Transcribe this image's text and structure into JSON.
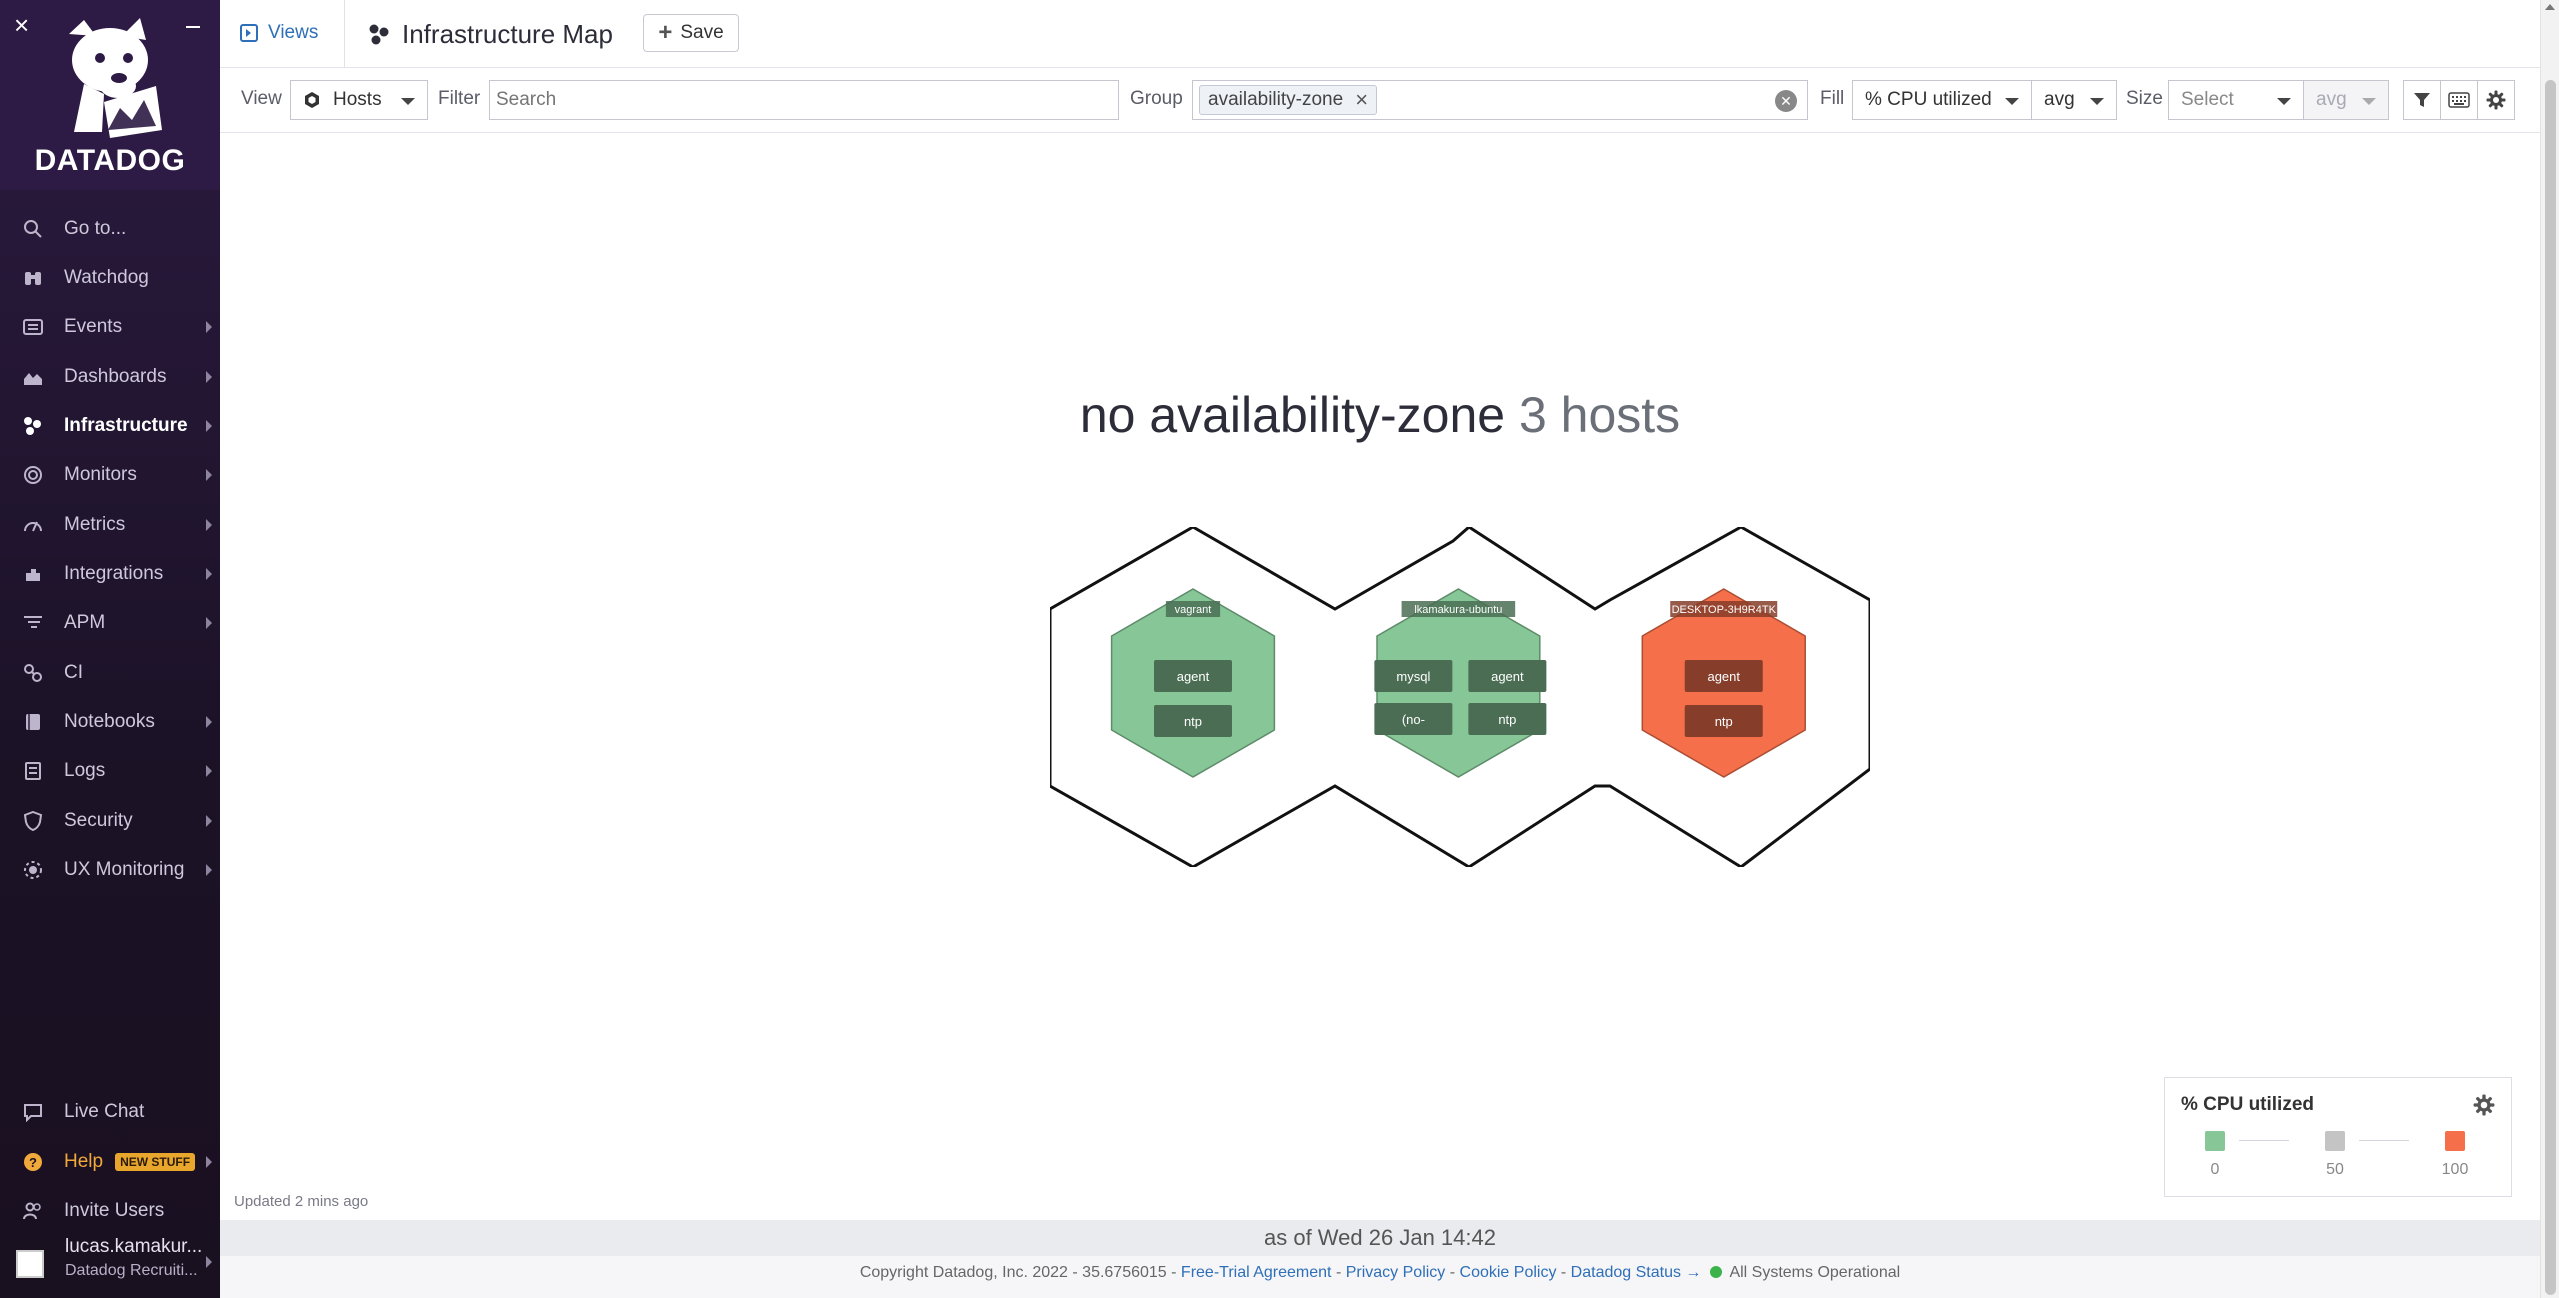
{
  "sidebar": {
    "logo_text": "DATADOG",
    "items": [
      {
        "label": "Go to...",
        "icon": "search-icon"
      },
      {
        "label": "Watchdog",
        "icon": "binoculars-icon"
      },
      {
        "label": "Events",
        "icon": "events-icon"
      },
      {
        "label": "Dashboards",
        "icon": "dashboards-icon"
      },
      {
        "label": "Infrastructure",
        "icon": "infrastructure-icon"
      },
      {
        "label": "Monitors",
        "icon": "monitors-icon"
      },
      {
        "label": "Metrics",
        "icon": "metrics-icon"
      },
      {
        "label": "Integrations",
        "icon": "integrations-icon"
      },
      {
        "label": "APM",
        "icon": "apm-icon"
      },
      {
        "label": "CI",
        "icon": "ci-icon"
      },
      {
        "label": "Notebooks",
        "icon": "notebooks-icon"
      },
      {
        "label": "Logs",
        "icon": "logs-icon"
      },
      {
        "label": "Security",
        "icon": "security-icon"
      },
      {
        "label": "UX Monitoring",
        "icon": "ux-monitoring-icon"
      }
    ],
    "bottom": {
      "live_chat": "Live Chat",
      "help": "Help",
      "help_badge": "NEW STUFF",
      "invite_users": "Invite Users",
      "user_name": "lucas.kamakur...",
      "user_org": "Datadog Recruiti..."
    }
  },
  "header": {
    "views_label": "Views",
    "title": "Infrastructure Map",
    "save_label": "Save"
  },
  "toolbar": {
    "view_label": "View",
    "view_value": "Hosts",
    "filter_label": "Filter",
    "filter_placeholder": "Search",
    "group_label": "Group",
    "group_tag": "availability-zone",
    "fill_label": "Fill",
    "fill_metric": "% CPU utilized",
    "fill_agg": "avg",
    "size_label": "Size",
    "size_placeholder": "Select",
    "size_agg": "avg"
  },
  "map": {
    "group_name": "no availability-zone",
    "host_count": "3 hosts",
    "hosts": [
      {
        "name": "vagrant",
        "cpu": 10,
        "color": "#86c697",
        "apps": [
          "agent",
          "ntp"
        ]
      },
      {
        "name": "lkamakura-ubuntu",
        "cpu": 12,
        "color": "#86c697",
        "apps": [
          "mysql",
          "agent",
          "(no-",
          "ntp"
        ]
      },
      {
        "name": "DESKTOP-3H9R4TK",
        "cpu": 95,
        "color": "#f46f4a",
        "apps": [
          "agent",
          "ntp"
        ]
      }
    ]
  },
  "legend": {
    "title": "% CPU utilized",
    "stops": [
      {
        "value": "0",
        "color": "#86c697"
      },
      {
        "value": "50",
        "color": "#c4c4c4"
      },
      {
        "value": "100",
        "color": "#f46f4a"
      }
    ]
  },
  "status": {
    "updated": "Updated 2 mins ago",
    "as_of": "as of Wed 26 Jan 14:42"
  },
  "footer": {
    "copyright": "Copyright Datadog, Inc. 2022 - 35.6756015 -",
    "free_trial": "Free-Trial Agreement",
    "privacy": "Privacy Policy",
    "cookie": "Cookie Policy",
    "status": "Datadog Status →",
    "operational": "All Systems Operational"
  }
}
